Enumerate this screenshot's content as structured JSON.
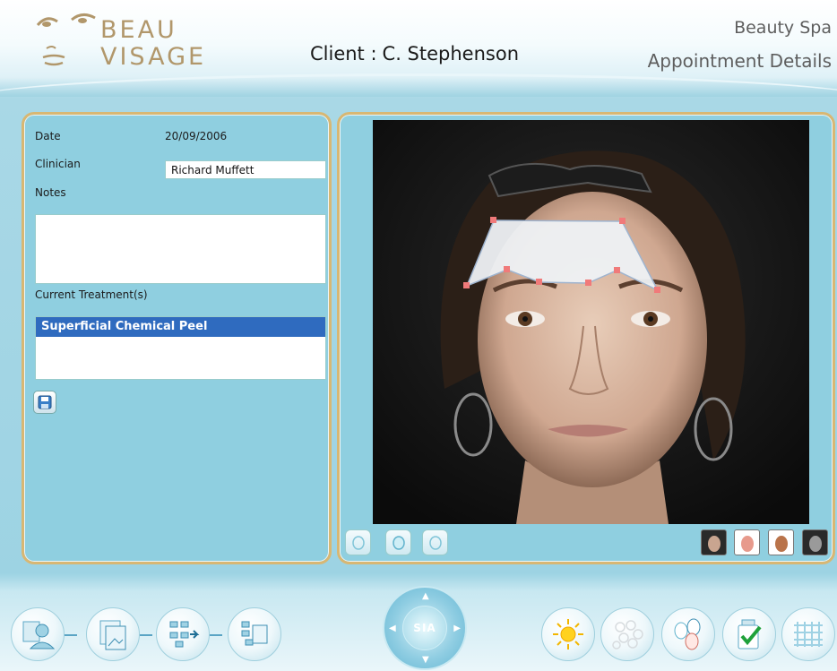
{
  "brand": {
    "line1": "BEAU",
    "line2": "VISAGE"
  },
  "client": {
    "label": "Client :",
    "name": "C. Stephenson"
  },
  "header_right": {
    "title": "Beauty Spa",
    "subtitle": "Appointment Details"
  },
  "form": {
    "date_label": "Date",
    "date_value": "20/09/2006",
    "clinician_label": "Clinician",
    "clinician_value": "Richard Muffett",
    "notes_label": "Notes",
    "notes_value": "",
    "treatments_label": "Current Treatment(s)",
    "treatments": [
      "Superficial Chemical Peel"
    ]
  },
  "nav": {
    "center_label": "SIA"
  },
  "colors": {
    "gold": "#d8b773",
    "panel": "#8fcfe0",
    "selection": "#2f6bbf",
    "brand": "#b1976b"
  },
  "icons": {
    "footer_left": [
      "client-icon",
      "images-icon",
      "workflow-icon",
      "compare-icon"
    ],
    "footer_right": [
      "sun-icon",
      "pores-icon",
      "faces-icon",
      "product-check-icon",
      "grid-icon"
    ]
  }
}
